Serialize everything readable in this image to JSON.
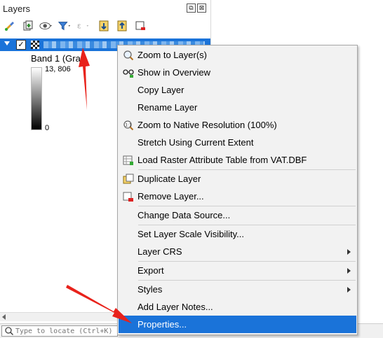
{
  "panel": {
    "title": "Layers",
    "float_label": "⧉",
    "close_label": "⊠",
    "toolbar": [
      "style-manager-icon",
      "add-group-icon",
      "visibility-eye-icon",
      "filter-legend-icon",
      "filter-expression-icon",
      "expand-all-icon",
      "collapse-all-icon",
      "remove-layer-icon"
    ]
  },
  "layer": {
    "checked": "✓",
    "band_label": "Band 1 (Gra",
    "max_value": "13, 806",
    "min_value": "0"
  },
  "locator": {
    "placeholder": "Type to locate (Ctrl+K)"
  },
  "menu": {
    "items": [
      {
        "label": "Zoom to Layer(s)",
        "icon": "magnifier-icon"
      },
      {
        "label": "Show in Overview",
        "icon": "glasses-icon"
      },
      {
        "label": "Copy Layer"
      },
      {
        "label": "Rename Layer"
      },
      {
        "label": "Zoom to Native Resolution (100%)",
        "icon": "zoom-native-icon"
      },
      {
        "label": "Stretch Using Current Extent"
      },
      {
        "label": "Load Raster Attribute Table from VAT.DBF",
        "icon": "table-load-icon"
      },
      {
        "label": "Duplicate Layer",
        "icon": "duplicate-icon"
      },
      {
        "label": "Remove Layer...",
        "icon": "remove-layer-icon"
      },
      {
        "label": "Change Data Source..."
      },
      {
        "label": "Set Layer Scale Visibility..."
      },
      {
        "label": "Layer CRS"
      },
      {
        "label": "Export"
      },
      {
        "label": "Styles"
      },
      {
        "label": "Add Layer Notes..."
      },
      {
        "label": "Properties..."
      }
    ]
  },
  "colors": {
    "selection": "#1a73d9",
    "annotation_arrow": "#e8221b"
  }
}
